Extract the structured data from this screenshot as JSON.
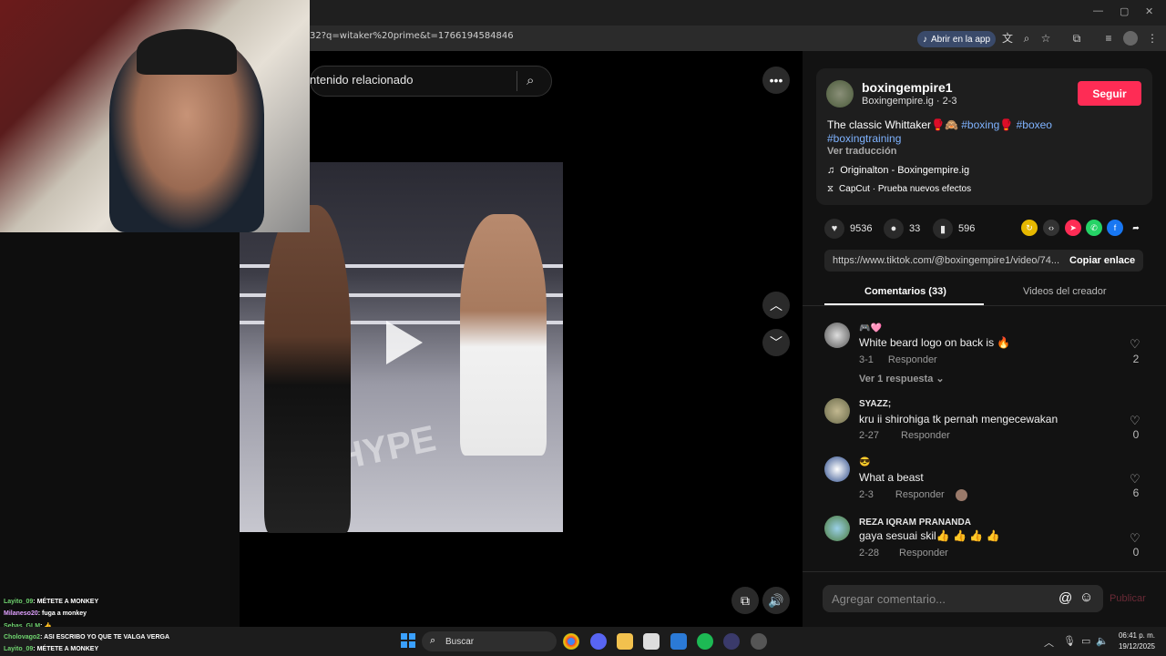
{
  "browser": {
    "url": "32?q=witaker%20prime&t=1766194584846",
    "open_app": "Abrir en la app"
  },
  "search": {
    "placeholder": "ntenido relacionado"
  },
  "video": {
    "mat_text": "HYPE"
  },
  "author": {
    "username": "boxingempire1",
    "subtitle": "Boxingempire.ig · 2-3",
    "follow_label": "Seguir",
    "caption_text": "The classic Whittaker🥊🙈 ",
    "hashtag1": "#boxing",
    "caption_emoji": "🥊",
    "hashtag2": "#boxeo",
    "hashtag3": "#boxingtraining",
    "translate": "Ver traducción",
    "music": "Originalton - Boxingempire.ig",
    "effect": "CapCut · Prueba nuevos efectos"
  },
  "stats": {
    "likes": "9536",
    "comments": "33",
    "saves": "596"
  },
  "link": {
    "url": "https://www.tiktok.com/@boxingempire1/video/74...",
    "copy_label": "Copiar enlace"
  },
  "tabs": {
    "comments": "Comentarios (33)",
    "creator": "Videos del creador"
  },
  "comments": [
    {
      "name": "🎮🩷",
      "text": "White beard logo on back is 🔥",
      "date": "3-1",
      "reply": "Responder",
      "likes": "2",
      "replies": "Ver 1 respuesta"
    },
    {
      "name": "SYAZZ;",
      "text": "kru ii shirohiga tk pernah mengecewakan",
      "date": "2-27",
      "reply": "Responder",
      "likes": "0"
    },
    {
      "name": "😎",
      "text": "What a beast",
      "date": "2-3",
      "reply": "Responder",
      "likes": "6"
    },
    {
      "name": "REZA IQRAM PRANANDA",
      "text": "gaya sesuai skil👍 👍 👍 👍",
      "date": "2-28",
      "reply": "Responder",
      "likes": "0"
    }
  ],
  "comment_input": {
    "placeholder": "Agregar comentario...",
    "publish": "Publicar"
  },
  "chat": [
    {
      "user": "Layito_09",
      "msg": ": MÉTETE A MONKEY",
      "color": "#6fd46f"
    },
    {
      "user": "Milaneso20",
      "msg": ": fuga a monkey",
      "color": "#e0a0ff"
    },
    {
      "user": "Sebas_GLM",
      "msg": ": 👍",
      "color": "#6fd46f"
    },
    {
      "user": "Cholovago2",
      "msg": ": ASI ESCRIBO YO QUE TE VALGA VERGA",
      "color": "#6fd46f"
    },
    {
      "user": "Layito_09",
      "msg": ": MÉTETE A MONKEY",
      "color": "#6fd46f"
    }
  ],
  "taskbar": {
    "search": "Buscar",
    "time": "06:41 p. m.",
    "date": "19/12/2025"
  },
  "colors": {
    "accent": "#fe2c55",
    "hashtag": "#7fb3ff"
  }
}
